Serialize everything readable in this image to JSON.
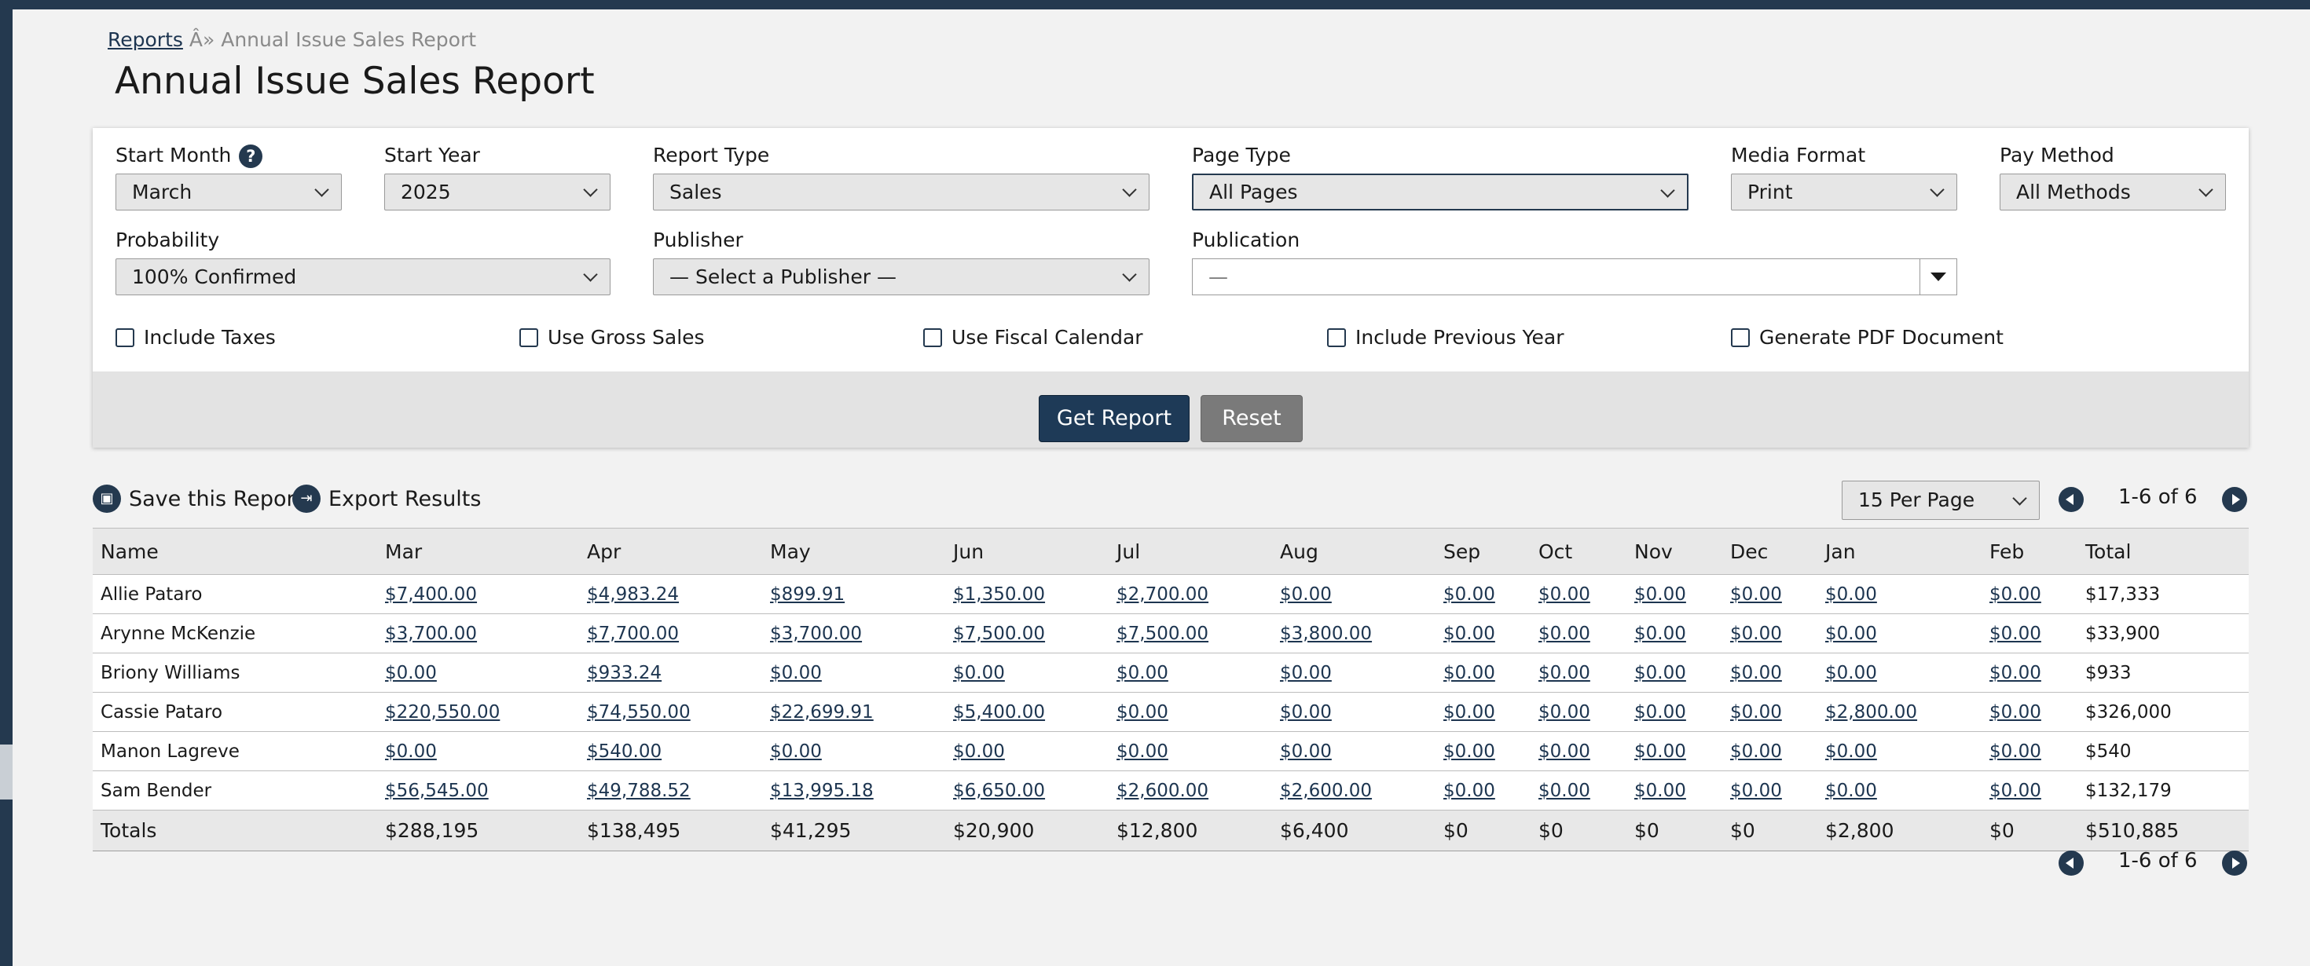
{
  "breadcrumb": {
    "root": "Reports",
    "separator": "Â»",
    "current": "Annual Issue Sales Report"
  },
  "page_title": "Annual Issue Sales Report",
  "filters": {
    "start_month": {
      "label": "Start Month",
      "value": "March",
      "help_icon": "question-mark-icon"
    },
    "start_year": {
      "label": "Start Year",
      "value": "2025"
    },
    "report_type": {
      "label": "Report Type",
      "value": "Sales"
    },
    "page_type": {
      "label": "Page Type",
      "value": "All Pages"
    },
    "media_format": {
      "label": "Media Format",
      "value": "Print"
    },
    "pay_method": {
      "label": "Pay Method",
      "value": "All Methods"
    },
    "probability": {
      "label": "Probability",
      "value": "100% Confirmed"
    },
    "publisher": {
      "label": "Publisher",
      "value": "— Select a Publisher —"
    },
    "publication": {
      "label": "Publication",
      "value": "—"
    }
  },
  "checkboxes": {
    "include_taxes": "Include Taxes",
    "use_gross_sales": "Use Gross Sales",
    "use_fiscal_calendar": "Use Fiscal Calendar",
    "include_previous_year": "Include Previous Year",
    "generate_pdf": "Generate PDF Document"
  },
  "buttons": {
    "get_report": "Get Report",
    "reset": "Reset"
  },
  "actions": {
    "save_report": "Save this Report",
    "export_results": "Export Results"
  },
  "pagination": {
    "per_page": "15 Per Page",
    "range": "1-6 of 6"
  },
  "table": {
    "headers": [
      "Name",
      "Mar",
      "Apr",
      "May",
      "Jun",
      "Jul",
      "Aug",
      "Sep",
      "Oct",
      "Nov",
      "Dec",
      "Jan",
      "Feb",
      "Total"
    ],
    "rows": [
      [
        "Allie Pataro",
        "$7,400.00",
        "$4,983.24",
        "$899.91",
        "$1,350.00",
        "$2,700.00",
        "$0.00",
        "$0.00",
        "$0.00",
        "$0.00",
        "$0.00",
        "$0.00",
        "$0.00",
        "$17,333"
      ],
      [
        "Arynne McKenzie",
        "$3,700.00",
        "$7,700.00",
        "$3,700.00",
        "$7,500.00",
        "$7,500.00",
        "$3,800.00",
        "$0.00",
        "$0.00",
        "$0.00",
        "$0.00",
        "$0.00",
        "$0.00",
        "$33,900"
      ],
      [
        "Briony Williams",
        "$0.00",
        "$933.24",
        "$0.00",
        "$0.00",
        "$0.00",
        "$0.00",
        "$0.00",
        "$0.00",
        "$0.00",
        "$0.00",
        "$0.00",
        "$0.00",
        "$933"
      ],
      [
        "Cassie Pataro",
        "$220,550.00",
        "$74,550.00",
        "$22,699.91",
        "$5,400.00",
        "$0.00",
        "$0.00",
        "$0.00",
        "$0.00",
        "$0.00",
        "$0.00",
        "$2,800.00",
        "$0.00",
        "$326,000"
      ],
      [
        "Manon Lagreve",
        "$0.00",
        "$540.00",
        "$0.00",
        "$0.00",
        "$0.00",
        "$0.00",
        "$0.00",
        "$0.00",
        "$0.00",
        "$0.00",
        "$0.00",
        "$0.00",
        "$540"
      ],
      [
        "Sam Bender",
        "$56,545.00",
        "$49,788.52",
        "$13,995.18",
        "$6,650.00",
        "$2,600.00",
        "$2,600.00",
        "$0.00",
        "$0.00",
        "$0.00",
        "$0.00",
        "$0.00",
        "$0.00",
        "$132,179"
      ]
    ],
    "totals": [
      "Totals",
      "$288,195",
      "$138,495",
      "$41,295",
      "$20,900",
      "$12,800",
      "$6,400",
      "$0",
      "$0",
      "$0",
      "$0",
      "$2,800",
      "$0",
      "$510,885"
    ]
  },
  "colors": {
    "brand": "#24394f",
    "primary_button": "#1e3a57",
    "secondary_button": "#7a7a7a",
    "link": "#1d3550"
  }
}
